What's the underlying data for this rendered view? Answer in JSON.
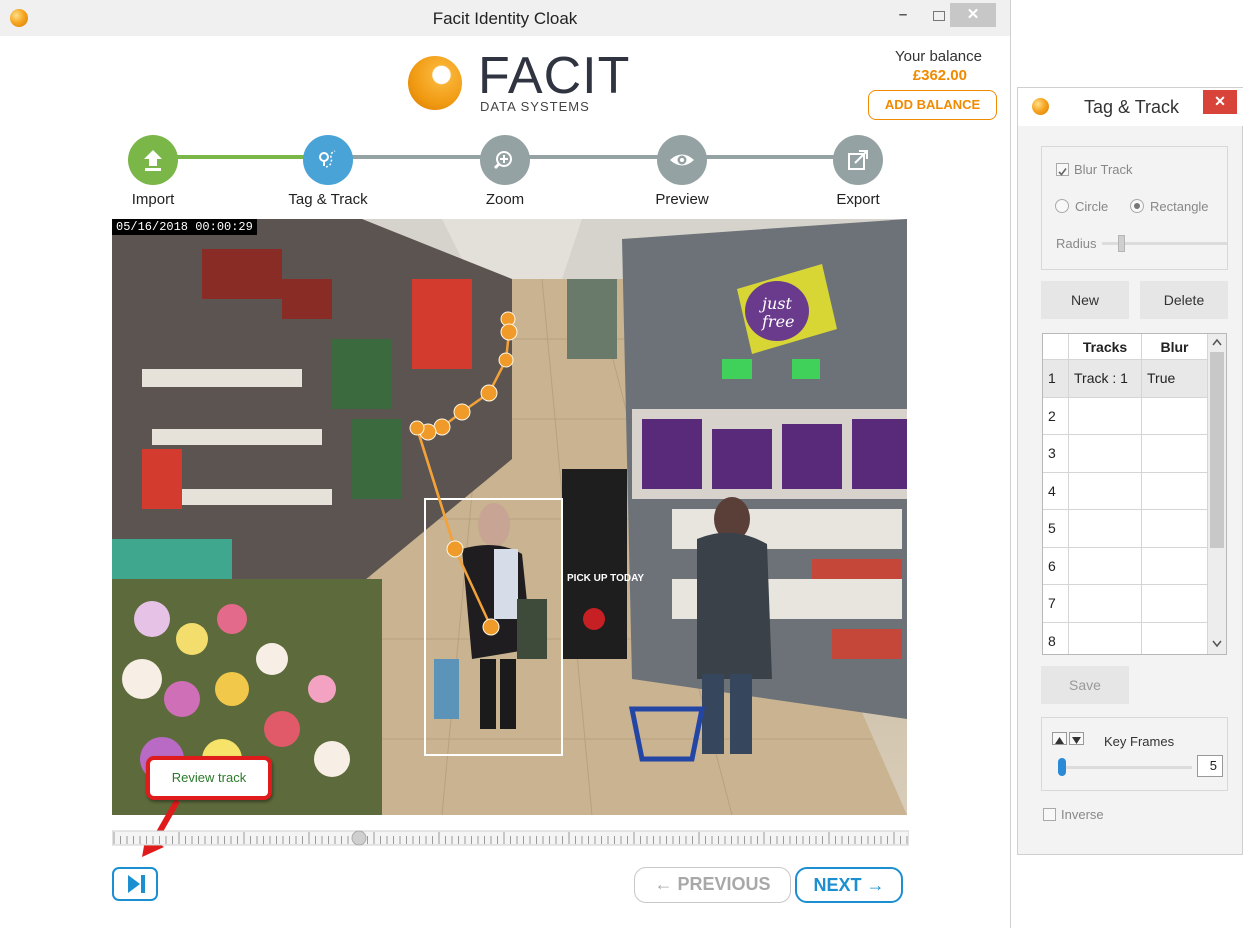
{
  "window": {
    "title": "Facit Identity Cloak"
  },
  "logo": {
    "word": "FACIT",
    "sub": "DATA SYSTEMS"
  },
  "balance": {
    "label": "Your balance",
    "value": "£362.00",
    "button": "ADD BALANCE"
  },
  "steps": [
    {
      "label": "Import",
      "icon": "upload-icon",
      "color": "#7ab648"
    },
    {
      "label": "Tag & Track",
      "icon": "track-icon",
      "color": "#4aa3d6"
    },
    {
      "label": "Zoom",
      "icon": "zoom-in-icon",
      "color": "#95a2a3"
    },
    {
      "label": "Preview",
      "icon": "eye-icon",
      "color": "#95a2a3"
    },
    {
      "label": "Export",
      "icon": "export-icon",
      "color": "#95a2a3"
    }
  ],
  "video": {
    "timestamp": "05/16/2018 00:00:29",
    "sign_text": "PICK UP TODAY"
  },
  "callout": {
    "text": "Review track"
  },
  "nav": {
    "previous": "PREVIOUS",
    "next": "NEXT"
  },
  "panel": {
    "title": "Tag & Track",
    "blur_track_label": "Blur Track",
    "blur_track_checked": true,
    "shape_circle": "Circle",
    "shape_rectangle": "Rectangle",
    "shape_selected": "Rectangle",
    "radius_label": "Radius",
    "new_button": "New",
    "delete_button": "Delete",
    "table_headers": [
      "Tracks",
      "Blur"
    ],
    "rows": [
      {
        "num": "1",
        "track": "Track : 1",
        "blur": "True"
      },
      {
        "num": "2",
        "track": "",
        "blur": ""
      },
      {
        "num": "3",
        "track": "",
        "blur": ""
      },
      {
        "num": "4",
        "track": "",
        "blur": ""
      },
      {
        "num": "5",
        "track": "",
        "blur": ""
      },
      {
        "num": "6",
        "track": "",
        "blur": ""
      },
      {
        "num": "7",
        "track": "",
        "blur": ""
      },
      {
        "num": "8",
        "track": "",
        "blur": ""
      }
    ],
    "save_button": "Save",
    "key_frames_label": "Key Frames",
    "key_frames_value": "5",
    "inverse_label": "Inverse",
    "inverse_checked": false
  },
  "colors": {
    "accent_orange": "#f08a00",
    "accent_blue": "#1b8fd0",
    "done_green": "#7ab648"
  }
}
